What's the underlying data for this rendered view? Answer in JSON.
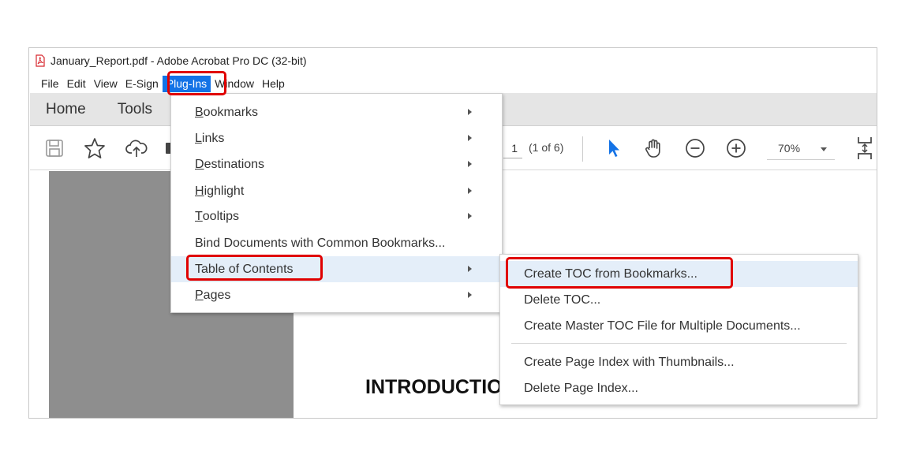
{
  "window": {
    "title": "January_Report.pdf - Adobe Acrobat Pro DC (32-bit)"
  },
  "menubar": {
    "items": [
      "File",
      "Edit",
      "View",
      "E-Sign",
      "Plug-Ins",
      "Window",
      "Help"
    ],
    "active": "Plug-Ins"
  },
  "tabs": [
    "Home",
    "Tools"
  ],
  "toolbar": {
    "page_current": "1",
    "page_total": "(1 of 6)",
    "zoom": "70%"
  },
  "plugins_menu": {
    "items": [
      {
        "pre": "",
        "ul": "B",
        "post": "ookmarks",
        "submenu": true
      },
      {
        "pre": "",
        "ul": "L",
        "post": "inks",
        "submenu": true
      },
      {
        "pre": "",
        "ul": "D",
        "post": "estinations",
        "submenu": true
      },
      {
        "pre": "",
        "ul": "H",
        "post": "ighlight",
        "submenu": true
      },
      {
        "pre": "",
        "ul": "T",
        "post": "ooltips",
        "submenu": true
      },
      {
        "pre": "Bind Documents with Common Bookmarks...",
        "ul": "",
        "post": "",
        "submenu": false
      },
      {
        "pre": "Table of Contents",
        "ul": "",
        "post": "",
        "submenu": true
      },
      {
        "pre": "",
        "ul": "P",
        "post": "ages",
        "submenu": true
      }
    ]
  },
  "toc_submenu": {
    "items": [
      "Create TOC from Bookmarks...",
      "Delete TOC...",
      "Create Master TOC File for Multiple Documents...",
      "Create Page Index with Thumbnails...",
      "Delete Page Index..."
    ]
  },
  "document": {
    "heading": "INTRODUCTIO"
  },
  "colors": {
    "accent": "#1473e6",
    "highlight": "#e00000",
    "menu_hover": "#e4eef9"
  }
}
